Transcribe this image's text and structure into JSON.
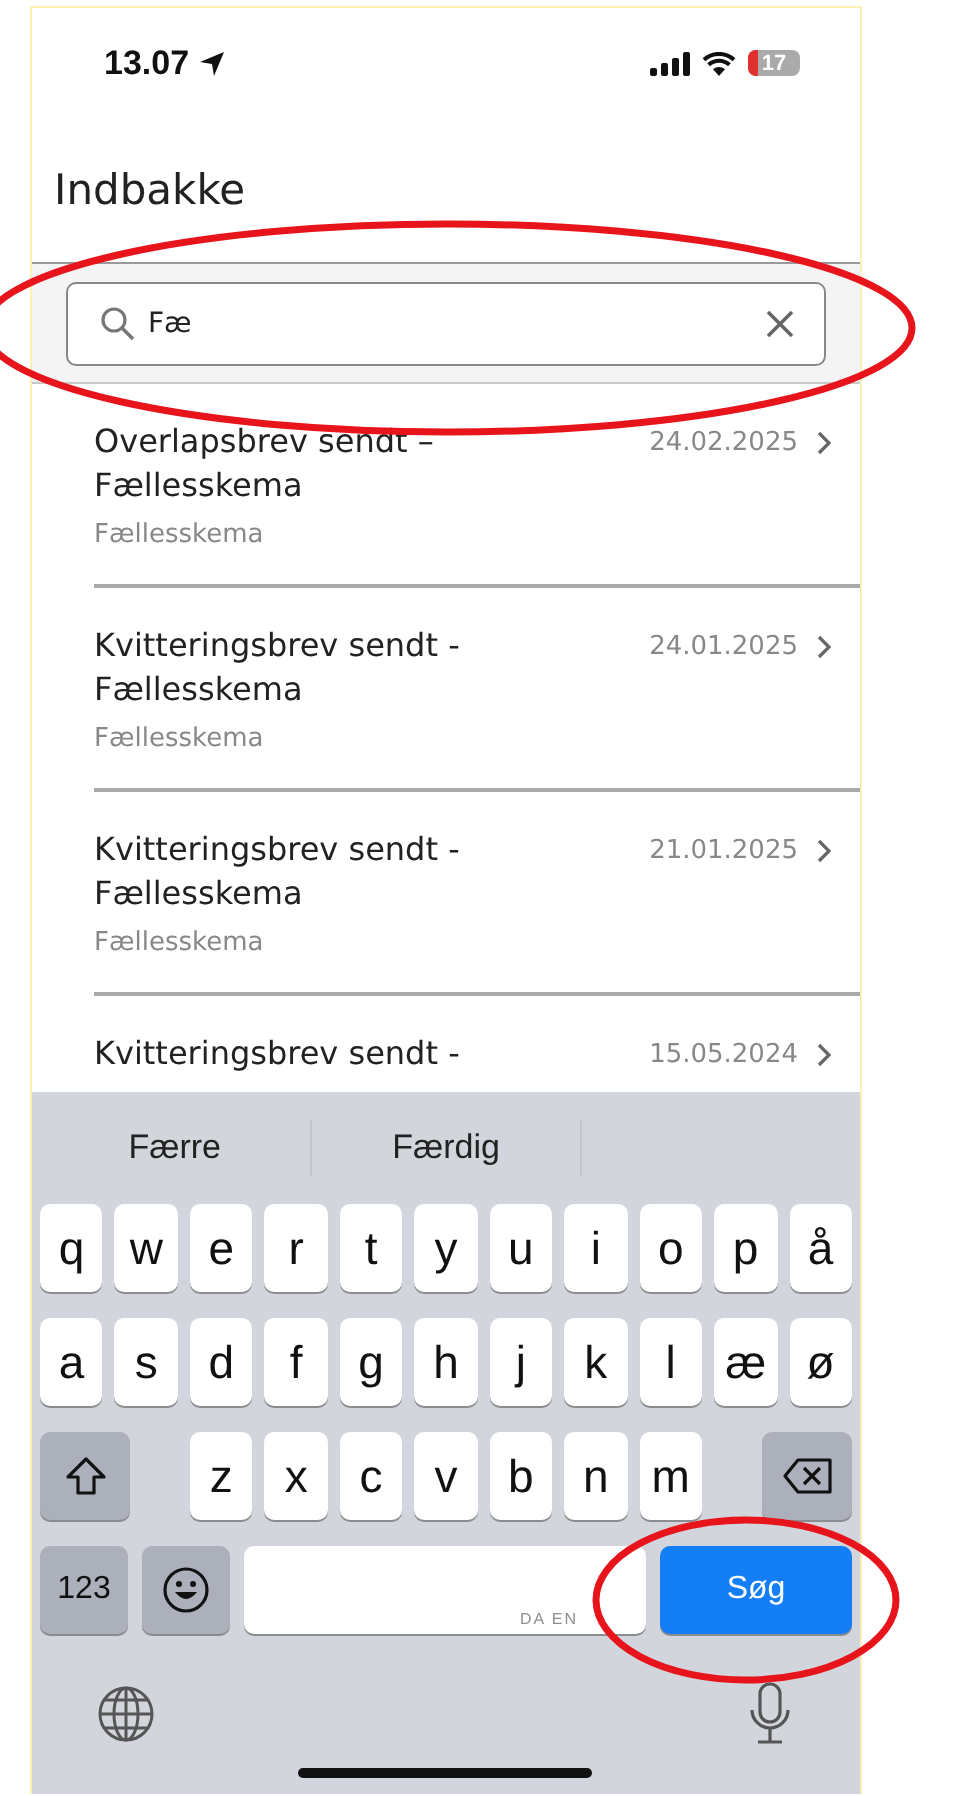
{
  "status_bar": {
    "time": "13.07",
    "battery": "17"
  },
  "header": {
    "title": "Indbakke"
  },
  "search": {
    "value": "Fæ",
    "highlighted": true
  },
  "messages": [
    {
      "title": "Overlapsbrev sendt – Fællesskema",
      "date": "24.02.2025",
      "sender": "Fællesskema"
    },
    {
      "title": "Kvitteringsbrev sendt - Fællesskema",
      "date": "24.01.2025",
      "sender": "Fællesskema"
    },
    {
      "title": "Kvitteringsbrev sendt - Fællesskema",
      "date": "21.01.2025",
      "sender": "Fællesskema"
    },
    {
      "title": "Kvitteringsbrev sendt -",
      "date": "15.05.2024"
    }
  ],
  "keyboard": {
    "suggestions": [
      "Færre",
      "Færdig"
    ],
    "rows": [
      [
        "q",
        "w",
        "e",
        "r",
        "t",
        "y",
        "u",
        "i",
        "o",
        "p",
        "å"
      ],
      [
        "a",
        "s",
        "d",
        "f",
        "g",
        "h",
        "j",
        "k",
        "l",
        "æ",
        "ø"
      ],
      [
        "",
        "",
        "z",
        "x",
        "c",
        "v",
        "b",
        "n",
        "m",
        "",
        ""
      ]
    ],
    "numbers_key": "123",
    "space_hint": "DA EN",
    "return_key": {
      "label": "Søg",
      "highlighted": true
    }
  }
}
